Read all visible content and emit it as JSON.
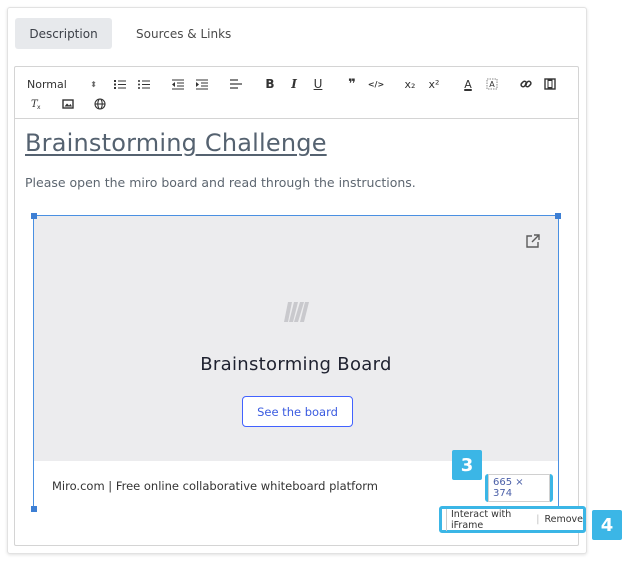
{
  "tabs": [
    {
      "label": "Description",
      "active": true
    },
    {
      "label": "Sources & Links",
      "active": false
    }
  ],
  "toolbar": {
    "format_select": "Normal",
    "bold": "B",
    "italic": "I",
    "underline": "U",
    "quote": "❞",
    "code": "</>",
    "subscript": "x₂",
    "superscript": "x²",
    "font_color": "A"
  },
  "content": {
    "heading": "Brainstorming Challenge",
    "paragraph": "Please open the miro board and read through the instructions."
  },
  "embed": {
    "board_title": "Brainstorming Board",
    "button_label": "See the board",
    "footer_text": "Miro.com | Free online collaborative whiteboard platform",
    "size_label": "665 × 374"
  },
  "actions": {
    "interact": "Interact with iFrame",
    "remove": "Remove"
  },
  "badges": {
    "size_badge": "3",
    "actions_badge": "4"
  },
  "colors": {
    "accent": "#3bb6e6",
    "miro_blue": "#4262ff",
    "selection": "#4a90e2"
  }
}
